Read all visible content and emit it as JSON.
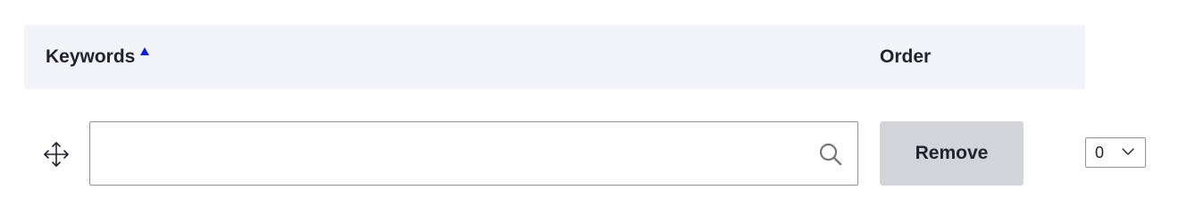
{
  "table": {
    "header": {
      "keywords_label": "Keywords",
      "order_label": "Order",
      "sort_direction": "ascending",
      "sort_icon": "sort-ascending-triangle"
    },
    "rows": [
      {
        "drag_icon": "move-arrows-icon",
        "search_value": "",
        "search_placeholder": "",
        "search_icon": "magnifier-icon",
        "remove_label": "Remove",
        "order_value": "0"
      }
    ]
  },
  "colors": {
    "header_bg": "#f3f4f9",
    "sort_accent": "#0a1aeb",
    "button_bg": "#d3d4d9",
    "text": "#222330",
    "border": "#8e929c"
  }
}
